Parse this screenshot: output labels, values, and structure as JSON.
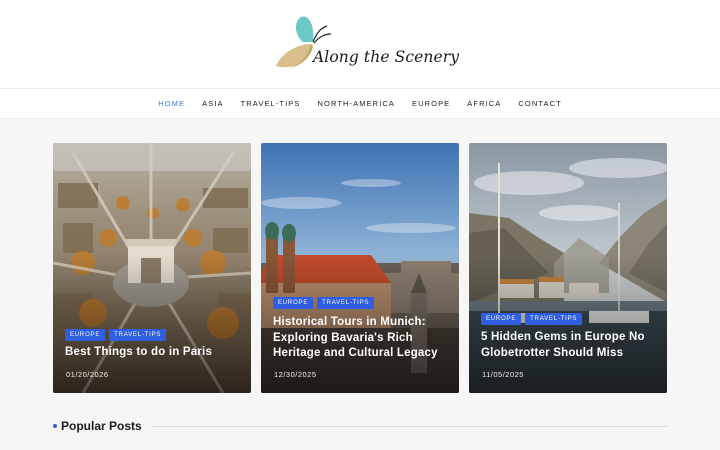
{
  "site": {
    "logo_text": "Along the Scenery"
  },
  "nav": {
    "items": [
      {
        "label": "HOME",
        "active": true
      },
      {
        "label": "ASIA"
      },
      {
        "label": "TRAVEL-TIPS"
      },
      {
        "label": "NORTH-AMERICA"
      },
      {
        "label": "EUROPE"
      },
      {
        "label": "AFRICA"
      },
      {
        "label": "CONTACT"
      }
    ]
  },
  "featured": [
    {
      "tags": [
        "EUROPE",
        "TRAVEL-TIPS"
      ],
      "title": "Best Things to do in Paris",
      "date": "01/20/2026"
    },
    {
      "tags": [
        "EUROPE",
        "TRAVEL-TIPS"
      ],
      "title": "Historical Tours in Munich: Exploring Bavaria's Rich Heritage and Cultural Legacy",
      "date": "12/30/2025"
    },
    {
      "tags": [
        "EUROPE",
        "TRAVEL-TIPS"
      ],
      "title": "5 Hidden Gems in Europe No Globetrotter Should Miss",
      "date": "11/05/2025"
    }
  ],
  "sections": {
    "popular_title": "Popular Posts"
  },
  "colors": {
    "accent": "#3f7ad8",
    "tag_bg": "#2f5fe0"
  }
}
